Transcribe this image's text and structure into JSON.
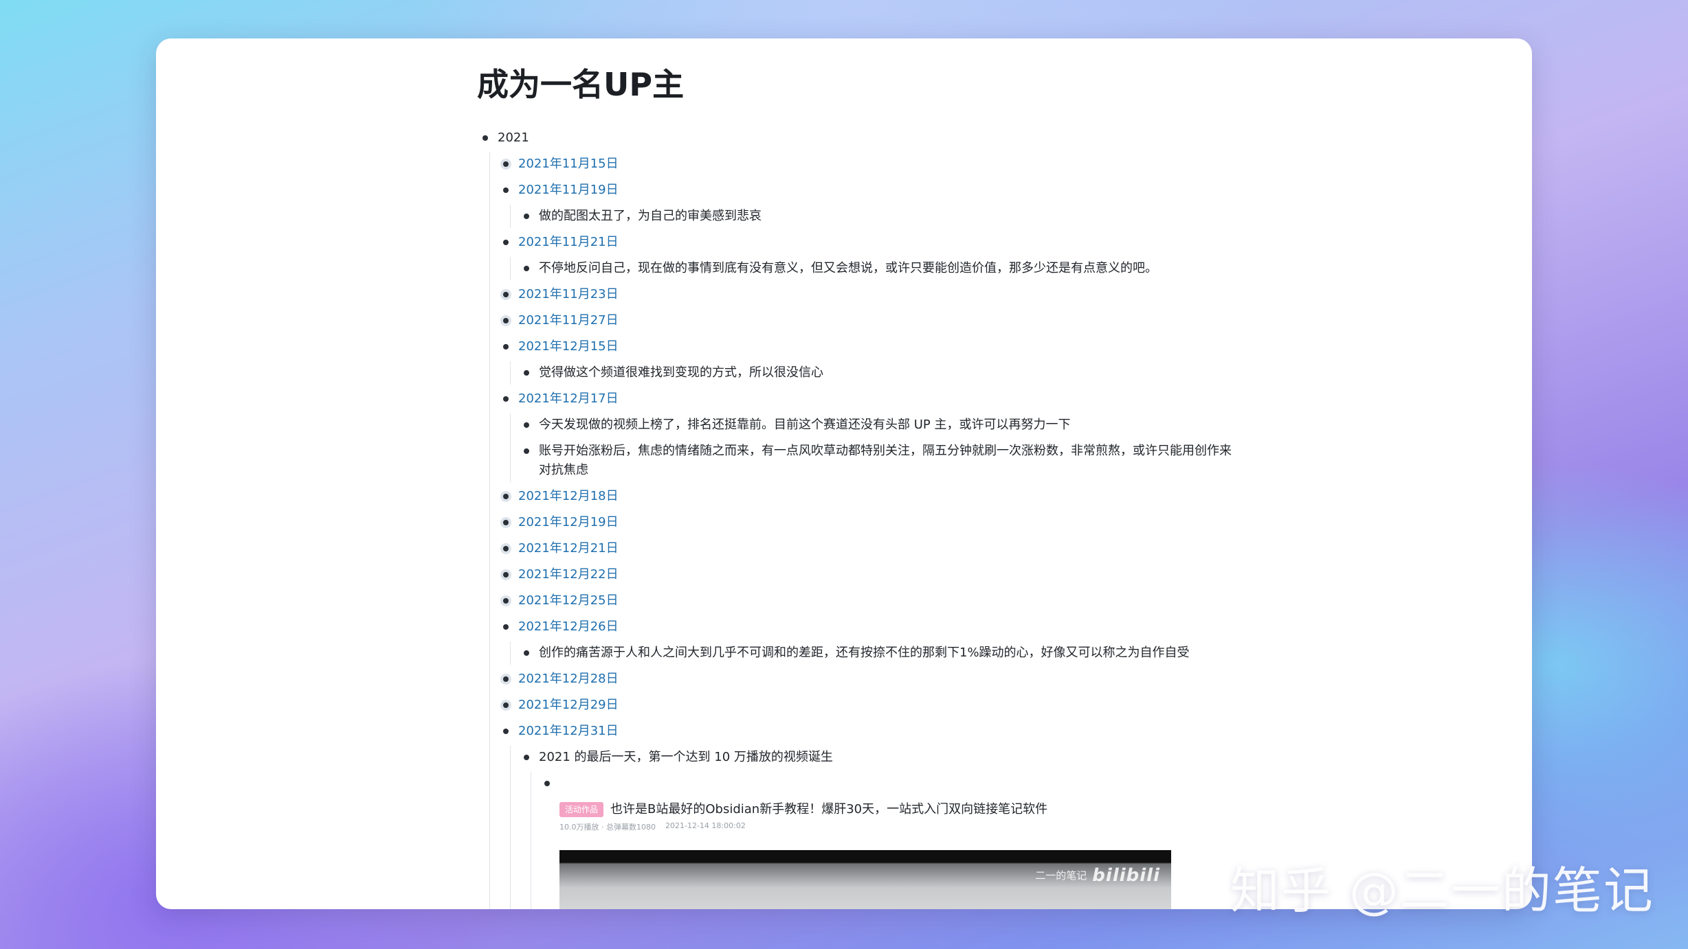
{
  "page": {
    "title": "成为一名UP主"
  },
  "outline": {
    "year": "2021",
    "entries": [
      {
        "date": "2021年11月15日",
        "notes": []
      },
      {
        "date": "2021年11月19日",
        "notes": [
          "做的配图太丑了，为自己的审美感到悲哀"
        ]
      },
      {
        "date": "2021年11月21日",
        "notes": [
          "不停地反问自己，现在做的事情到底有没有意义，但又会想说，或许只要能创造价值，那多少还是有点意义的吧。"
        ]
      },
      {
        "date": "2021年11月23日",
        "notes": []
      },
      {
        "date": "2021年11月27日",
        "notes": []
      },
      {
        "date": "2021年12月15日",
        "notes": [
          "觉得做这个频道很难找到变现的方式，所以很没信心"
        ]
      },
      {
        "date": "2021年12月17日",
        "notes": [
          "今天发现做的视频上榜了，排名还挺靠前。目前这个赛道还没有头部 UP 主，或许可以再努力一下",
          "账号开始涨粉后，焦虑的情绪随之而来，有一点风吹草动都特别关注，隔五分钟就刷一次涨粉数，非常煎熬，或许只能用创作来对抗焦虑"
        ]
      },
      {
        "date": "2021年12月18日",
        "notes": []
      },
      {
        "date": "2021年12月19日",
        "notes": []
      },
      {
        "date": "2021年12月21日",
        "notes": []
      },
      {
        "date": "2021年12月22日",
        "notes": []
      },
      {
        "date": "2021年12月25日",
        "notes": []
      },
      {
        "date": "2021年12月26日",
        "notes": [
          "创作的痛苦源于人和人之间大到几乎不可调和的差距，还有按捺不住的那剩下1%躁动的心，好像又可以称之为自作自受"
        ]
      },
      {
        "date": "2021年12月28日",
        "notes": []
      },
      {
        "date": "2021年12月29日",
        "notes": []
      },
      {
        "date": "2021年12月31日",
        "notes": [
          "2021 的最后一天，第一个达到 10 万播放的视频诞生"
        ]
      }
    ]
  },
  "video": {
    "badge": "活动作品",
    "title": "也许是B站最好的Obsidian新手教程！爆肝30天，一站式入门双向链接笔记软件",
    "views": "10.0万播放 · 总弹幕数1080",
    "date": "2021-12-14 18:00:02",
    "frame_caption": "二一的笔记",
    "frame_logo": "bilibili"
  },
  "watermark": {
    "text": "知乎 @二一的笔记"
  }
}
